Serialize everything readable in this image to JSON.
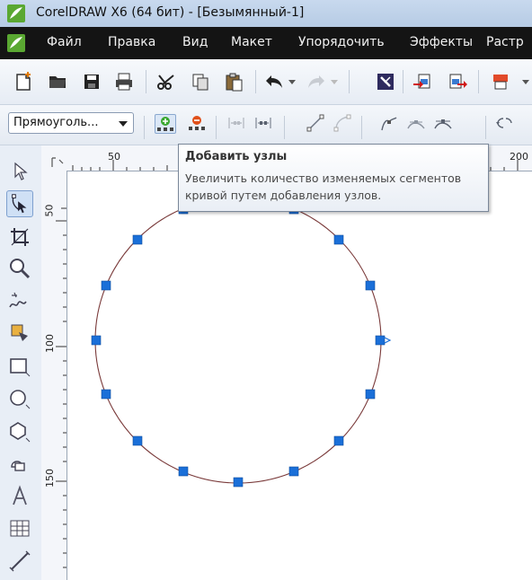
{
  "window": {
    "title": "CorelDRAW X6 (64 бит) - [Безымянный-1]"
  },
  "menu": {
    "items": [
      "Файл",
      "Правка",
      "Вид",
      "Макет",
      "Упорядочить",
      "Эффекты",
      "Растр"
    ]
  },
  "property_bar": {
    "selection_combo": "Прямоуголь...",
    "tools": [
      "add-nodes-icon",
      "delete-nodes-icon",
      "join-nodes-icon",
      "break-curve-icon",
      "to-line-icon",
      "to-curve-icon",
      "cusp-node-icon",
      "smooth-node-icon",
      "symmetrical-node-icon",
      "reverse-direction-icon"
    ]
  },
  "tooltip": {
    "title": "Добавить узлы",
    "body": "Увеличить количество изменяемых сегментов кривой путем добавления узлов."
  },
  "rulers": {
    "horizontal_labels": [
      "50",
      "200"
    ],
    "vertical_labels": [
      "50",
      "100",
      "150"
    ]
  },
  "toolbox": {
    "tools": [
      "pick-tool-icon",
      "shape-tool-icon",
      "crop-tool-icon",
      "zoom-tool-icon",
      "freehand-tool-icon",
      "smart-fill-tool-icon",
      "rectangle-tool-icon",
      "ellipse-tool-icon",
      "polygon-tool-icon",
      "basic-shapes-tool-icon",
      "text-tool-icon",
      "table-tool-icon",
      "dimension-tool-icon"
    ],
    "selected": "shape-tool-icon"
  },
  "colors": {
    "node": "#1a6fd8",
    "curve": "#7a3a3a",
    "menubar": "#141414"
  }
}
